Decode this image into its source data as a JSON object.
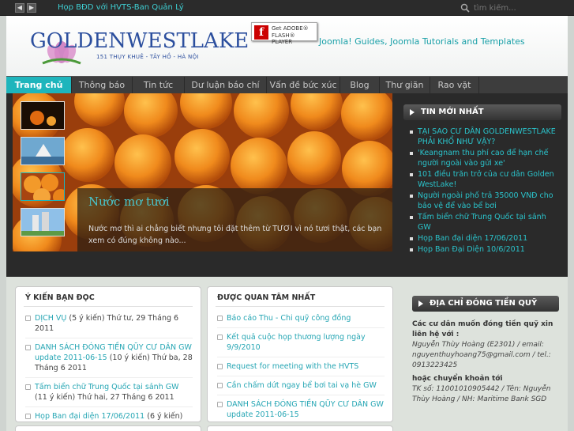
{
  "topbar": {
    "prev_icon": "chevron-left-icon",
    "next_icon": "chevron-right-icon",
    "ticker_text": "Họp BĐD với HVTS-Ban Quản Lý",
    "search_placeholder": "tìm kiếm..."
  },
  "header": {
    "logo_text": "GOLDENWESTLAKE",
    "logo_sub": "151 THỤY KHUÊ - TÂY HỒ - HÀ NỘI",
    "flash_line1": "Get ADOBE®",
    "flash_line2": "FLASH® PLAYER",
    "flash_letter": "f",
    "tagline": "Joomla! Guides, Joomla Tutorials and Templates"
  },
  "menu": [
    {
      "label": "Trang chủ",
      "active": true
    },
    {
      "label": "Thông báo"
    },
    {
      "label": "Tin tức"
    },
    {
      "label": "Dư luận báo chí"
    },
    {
      "label": "Vấn đề bức xúc"
    },
    {
      "label": "Blog"
    },
    {
      "label": "Thư giãn"
    },
    {
      "label": "Rao vặt"
    }
  ],
  "slideshow": {
    "caption_title": "Nước mơ tươi",
    "caption_text": "Nước mơ thì ai chẳng biết nhưng tôi đặt thêm từ TƯƠI vì nó tươi thật, các bạn xem có đúng không nào..."
  },
  "latest_news": {
    "title": "TIN MỚI NHẤT",
    "items": [
      "TẠI SAO CƯ DÂN GOLDENWESTLAKE PHẢI KHỔ NHƯ VẬY?",
      "'Keangnam thu phí cao để hạn chế người ngoài vào gửi xe'",
      "101 điều trăn trở của cư dân Golden WestLake!",
      "Người ngoài phố trả 35000 VNĐ cho bảo vệ để vào bể bơi",
      "Tấm biển chữ Trung Quốc tại sảnh GW",
      "Họp Ban đại diện 17/06/2011",
      "Họp Ban Đại Diện 10/6/2011"
    ]
  },
  "comments": {
    "title": "Ý KIẾN BẠN ĐỌC",
    "items": [
      {
        "link": "DỊCH VỤ",
        "meta": " (5 ý kiến) Thứ tư, 29 Tháng 6 2011"
      },
      {
        "link": "DANH SÁCH ĐÓNG TIỀN QŨY CƯ DÂN GW update 2011-06-15",
        "meta": " (10 ý kiến) Thứ ba, 28 Tháng 6 2011"
      },
      {
        "link": "Tấm biển chữ Trung Quốc tại sảnh GW",
        "meta": " (11 ý kiến) Thứ hai, 27 Tháng 6 2011"
      },
      {
        "link": "Họp Ban đại diện 17/06/2011",
        "meta": " (6 ý kiến) Thứ hai, 20 Tháng 6 2011"
      }
    ]
  },
  "popular": {
    "title": "ĐƯỢC QUAN TÂM NHẤT",
    "items": [
      "Báo cáo Thu - Chi quỹ công đồng",
      "Kết quả cuộc họp thương lượng ngày 9/9/2010",
      "Request for meeting with the HVTS",
      "Cần chấm dứt ngay bể bơi tai vạ hè GW",
      "DANH SÁCH ĐÓNG TIỀN QŨY CƯ DÂN GW update 2011-06-15"
    ]
  },
  "fund": {
    "title": "ĐỊA CHỈ ĐÓNG TIỀN QUỸ",
    "intro": "Các cư dân muốn đóng tiền quỹ xin liên hệ với :",
    "contact": "Nguyễn Thùy Hoàng (E2301) / email: nguyenthuyhoang75@gmail.com / tel.: 0913223425",
    "alt": "hoặc chuyển khoản tới",
    "account": "TK số: 11001010905442 / Tên: Nguyễn Thùy Hoàng / NH: Maritime Bank SGD"
  },
  "colors": {
    "accent": "#1eb5bc",
    "link": "#26a6b4",
    "dark": "#2b2b2b"
  }
}
